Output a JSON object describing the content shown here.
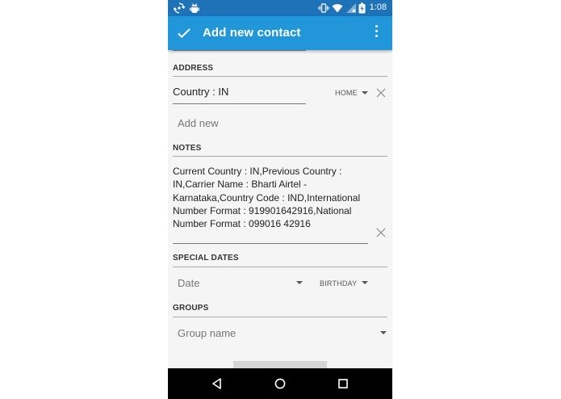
{
  "status_bar": {
    "time": "1:08",
    "left_icons": [
      "sync-icon",
      "android-debug-icon"
    ],
    "right_icons": [
      "vibrate-icon",
      "wifi-icon",
      "no-sim-icon",
      "battery-charging-icon"
    ]
  },
  "app_bar": {
    "title": "Add new contact",
    "save_icon": "check-icon",
    "menu_icon": "overflow-menu-icon",
    "background": "#2196d9"
  },
  "address": {
    "header": "ADDRESS",
    "value": "Country : IN",
    "type": "HOME",
    "add_new": "Add new"
  },
  "notes": {
    "header": "NOTES",
    "value": "Current Country : IN,Previous Country : IN,Carrier Name : Bharti Airtel - Karnataka,Country Code : IND,International Number Format : 919901642916,National Number Format : 099016 42916"
  },
  "special_dates": {
    "header": "SPECIAL DATES",
    "placeholder": "Date",
    "type": "BIRTHDAY"
  },
  "groups": {
    "header": "GROUPS",
    "placeholder": "Group name"
  },
  "nav_bar": {
    "icons": [
      "back-icon",
      "home-icon",
      "recents-icon"
    ]
  }
}
